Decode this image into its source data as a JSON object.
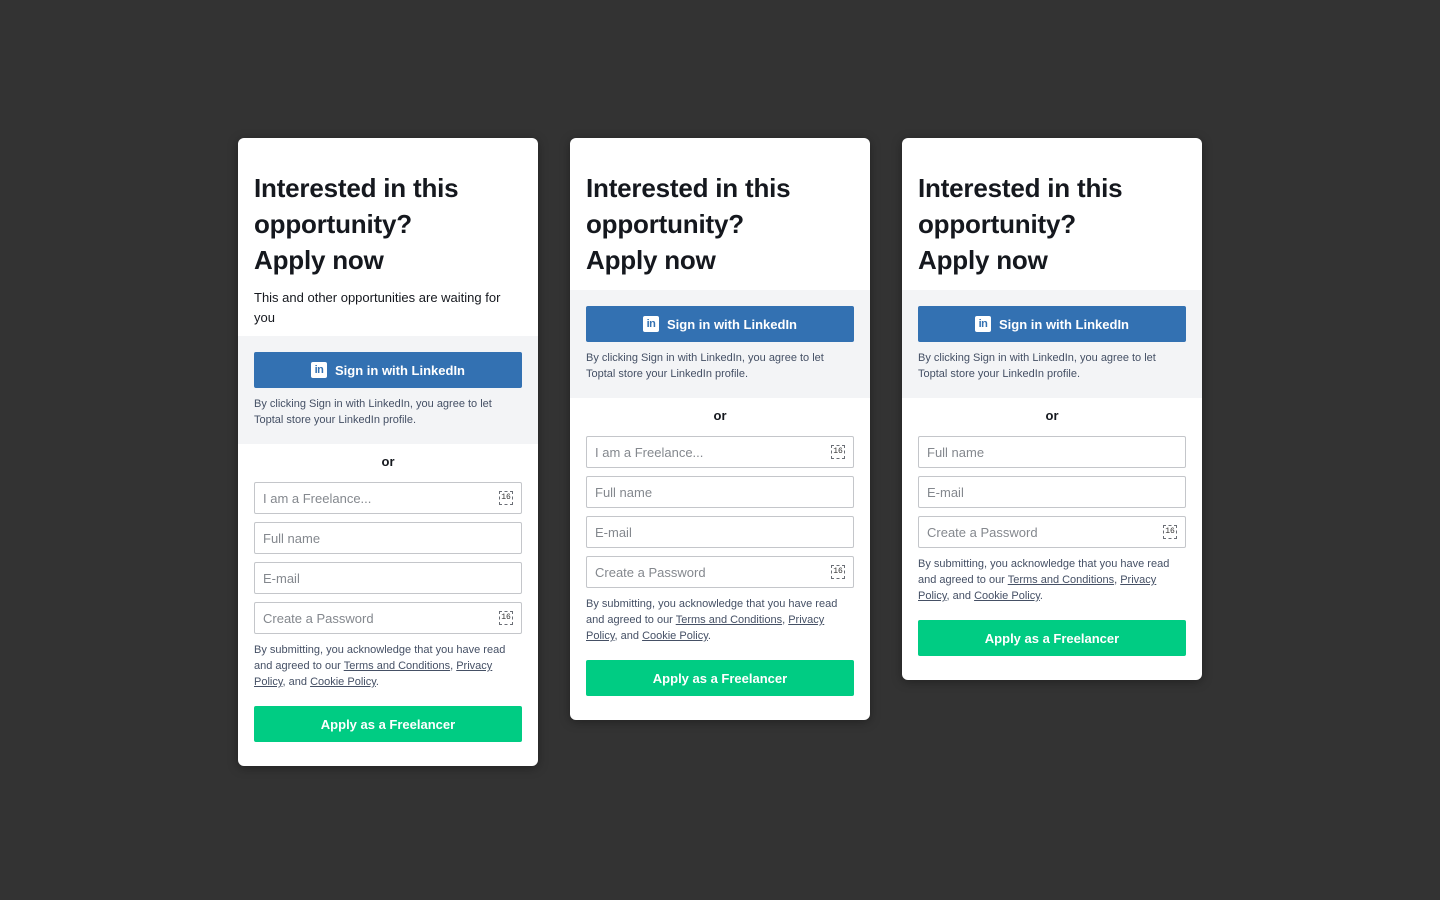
{
  "cards": [
    {
      "title_line1": "Interested in this",
      "title_line2": "opportunity?",
      "title_line3": "Apply now",
      "subtitle": "This and other opportunities are waiting for you",
      "linkedin_button": "Sign in with LinkedIn",
      "linkedin_note": "By clicking Sign in with LinkedIn, you agree to let Toptal store your LinkedIn profile.",
      "or": "or",
      "role_placeholder": "I am a Freelance...",
      "fullname_placeholder": "Full name",
      "email_placeholder": "E-mail",
      "password_placeholder": "Create a Password",
      "legal_prefix": "By submitting, you acknowledge that you have read and agreed to our ",
      "terms_link": "Terms and Conditions",
      "comma": ", ",
      "privacy_link": "Privacy Policy",
      "and_text": ", and ",
      "cookie_link": "Cookie Policy",
      "period": ".",
      "apply_button": "Apply as a Freelancer",
      "field_badge": "16"
    },
    {
      "title_line1": "Interested in this",
      "title_line2": "opportunity?",
      "title_line3": "Apply now",
      "linkedin_button": "Sign in with LinkedIn",
      "linkedin_note": "By clicking Sign in with LinkedIn, you agree to let Toptal store your LinkedIn profile.",
      "or": "or",
      "role_placeholder": "I am a Freelance...",
      "fullname_placeholder": "Full name",
      "email_placeholder": "E-mail",
      "password_placeholder": "Create a Password",
      "legal_prefix": "By submitting, you acknowledge that you have read and agreed to our ",
      "terms_link": "Terms and Conditions",
      "comma": ", ",
      "privacy_link": "Privacy Policy",
      "and_text": ", and ",
      "cookie_link": "Cookie Policy",
      "period": ".",
      "apply_button": "Apply as a Freelancer",
      "field_badge": "16"
    },
    {
      "title_line1": "Interested in this",
      "title_line2": "opportunity?",
      "title_line3": "Apply now",
      "linkedin_button": "Sign in with LinkedIn",
      "linkedin_note": "By clicking Sign in with LinkedIn, you agree to let Toptal store your LinkedIn profile.",
      "or": "or",
      "fullname_placeholder": "Full name",
      "email_placeholder": "E-mail",
      "password_placeholder": "Create a Password",
      "legal_prefix": "By submitting, you acknowledge that you have read and agreed to our ",
      "terms_link": "Terms and Conditions",
      "comma": ", ",
      "privacy_link": "Privacy Policy",
      "and_text": ", and ",
      "cookie_link": "Cookie Policy",
      "period": ".",
      "apply_button": "Apply as a Freelancer",
      "field_badge": "16"
    }
  ],
  "icons": {
    "linkedin": "linkedin-icon",
    "keyboard": "keyboard-16-icon"
  },
  "colors": {
    "background": "#333333",
    "card": "#ffffff",
    "linkedin_blue": "#3371b2",
    "apply_green": "#00cc83",
    "linkedin_area": "#f3f4f6",
    "text": "#15181e",
    "muted_text": "#455065"
  }
}
